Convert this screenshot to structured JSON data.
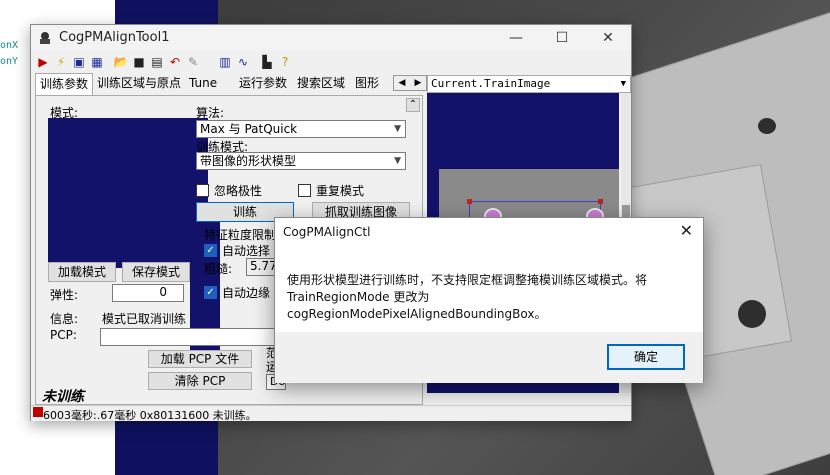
{
  "background": {
    "left_code_lines": [
      "onX",
      "onY"
    ]
  },
  "tool_window": {
    "title": "CogPMAlignTool1",
    "buttons": {
      "minimize": "—",
      "maximize": "☐",
      "close": "✕"
    },
    "toolbar_icons": [
      "run-icon",
      "electric-icon",
      "image-icon",
      "grid-icon",
      "open-folder-icon",
      "save-icon",
      "disk-icon",
      "reset-icon",
      "brush-icon",
      "graph-icon",
      "curve-icon",
      "histogram-icon",
      "help-icon"
    ],
    "tabs": [
      {
        "label": "训练参数",
        "active": true
      },
      {
        "label": "训练区域与原点",
        "active": false
      },
      {
        "label": "Tune",
        "active": false
      },
      {
        "label": "运行参数",
        "active": false
      },
      {
        "label": "搜索区域",
        "active": false
      },
      {
        "label": "图形",
        "active": false
      }
    ],
    "tab_scroll": {
      "left": "◀",
      "right": "▶"
    },
    "panel": {
      "pattern_label": "模式:",
      "algorithm_label": "算法:",
      "algorithm_value": "Max 与 PatQuick",
      "train_mode_label": "训练模式:",
      "train_mode_value": "带图像的形状模型",
      "ignore_polarity": "忽略极性",
      "duplicate_pattern": "重复模式",
      "train_button": "训练",
      "grab_train_image_button": "抓取训练图像",
      "feature_granularity_label": "特征粒度限制",
      "auto_select": "自动选择",
      "coarse_label": "粗糙:",
      "coarse_value": "5.77",
      "load_pattern_button": "加载模式",
      "save_pattern_button": "保存模式",
      "elasticity_label": "弹性:",
      "elasticity_value": "0",
      "auto_edge_label": "自动边缘",
      "info_label": "信息:",
      "info_value": "模式已取消训练",
      "pcp_label": "PCP:",
      "load_pcp_button": "加载 PCP 文件",
      "clear_pcp_button": "清除 PCP",
      "range_label": "范",
      "run_label": "运",
      "do_label": "Do",
      "untrained_label": "未训练",
      "collapse_glyph": "⌃"
    },
    "image_pane": {
      "selected_image": "Current.TrainImage"
    },
    "status_bar": "6003毫秒:.67毫秒 0x80131600  未训练。"
  },
  "dialog": {
    "title": "CogPMAlignCtl",
    "close": "✕",
    "message": "使用形状模型进行训练时，不支持限定框调整掩模训练区域模式。将 TrainRegionMode 更改为 cogRegionModePixelAlignedBoundingBox。",
    "ok_button": "确定"
  }
}
